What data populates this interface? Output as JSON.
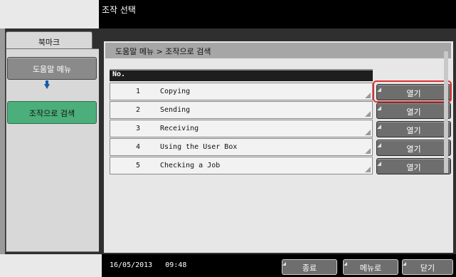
{
  "window": {
    "title": "조작 선택"
  },
  "sidebar": {
    "tab_label": "북마크",
    "help_menu_label": "도움말 메뉴",
    "search_label": "조작으로 검색"
  },
  "breadcrumb": "도움말 메뉴 > 조작으로 검색",
  "table": {
    "header": "No.",
    "rows": [
      {
        "num": "1",
        "name": "Copying",
        "button": "열기"
      },
      {
        "num": "2",
        "name": "Sending",
        "button": "열기"
      },
      {
        "num": "3",
        "name": "Receiving",
        "button": "열기"
      },
      {
        "num": "4",
        "name": "Using the User Box",
        "button": "열기"
      },
      {
        "num": "5",
        "name": "Checking a Job",
        "button": "열기"
      }
    ]
  },
  "status": {
    "date": "16/05/2013",
    "time": "09:48"
  },
  "footer": {
    "end_label": "종료",
    "menu_label": "메뉴로",
    "close_label": "닫기"
  },
  "colors": {
    "accent_green": "#4cae7a",
    "highlight_red": "#e03030"
  }
}
